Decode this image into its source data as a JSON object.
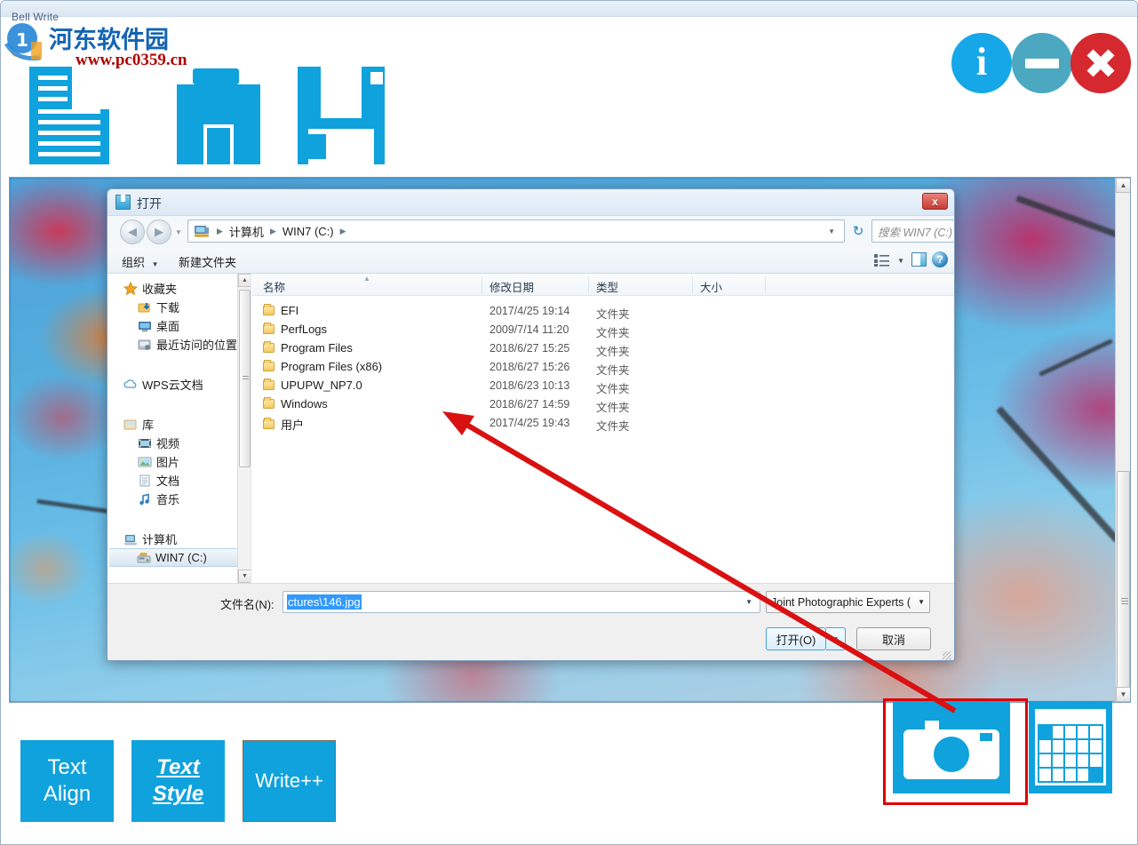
{
  "app": {
    "title": "Bell Write",
    "watermark": {
      "cn": "河东软件园",
      "url": "www.pc0359.cn"
    },
    "window_buttons": [
      {
        "name": "info",
        "glyph": "i",
        "color": "#16a7e8"
      },
      {
        "name": "minimize",
        "glyph": "",
        "color": "#4ca8c0"
      },
      {
        "name": "close",
        "glyph": "✕",
        "color": "#d5282f"
      }
    ],
    "top_tools": [
      {
        "name": "document-icon",
        "label": ""
      },
      {
        "name": "briefcase-icon",
        "label": ""
      },
      {
        "name": "save-floppy-icon",
        "label": ""
      }
    ],
    "bottom_buttons": [
      {
        "name": "text-align",
        "line1": "Text",
        "line2": "Align"
      },
      {
        "name": "text-style",
        "line1": "Text",
        "line2": "Style"
      },
      {
        "name": "write-plus-plus",
        "line1": "Write++",
        "line2": ""
      }
    ],
    "bottom_right_buttons": [
      {
        "name": "camera-icon",
        "label": ""
      },
      {
        "name": "table-grid-icon",
        "label": ""
      }
    ],
    "accent_color": "#0fa2dd",
    "highlight_color": "#e00000"
  },
  "dialog": {
    "title": "打开",
    "close_label": "x",
    "nav": {
      "back": "◀",
      "forward": "▶",
      "history_caret": "▼",
      "address_crumbs": [
        "计算机",
        "WIN7 (C:)"
      ],
      "crumb_sep": "▶",
      "address_caret": "▼",
      "refresh": "↻"
    },
    "search": {
      "placeholder": "搜索 WIN7 (C:)",
      "icon": "search-icon"
    },
    "commands": {
      "organize": "组织",
      "organize_caret": "▼",
      "new_folder": "新建文件夹",
      "view_caret": "▼",
      "help": "?"
    },
    "sidebar": [
      {
        "label": "收藏夹",
        "icon": "star-icon",
        "level": "group"
      },
      {
        "label": "下载",
        "icon": "download-icon",
        "level": "child"
      },
      {
        "label": "桌面",
        "icon": "desktop-icon",
        "level": "child"
      },
      {
        "label": "最近访问的位置",
        "icon": "recent-icon",
        "level": "child"
      },
      {
        "label": "WPS云文档",
        "icon": "cloud-icon",
        "level": "group"
      },
      {
        "label": "库",
        "icon": "library-icon",
        "level": "group"
      },
      {
        "label": "视频",
        "icon": "video-icon",
        "level": "child"
      },
      {
        "label": "图片",
        "icon": "picture-icon",
        "level": "child"
      },
      {
        "label": "文档",
        "icon": "document-icon",
        "level": "child"
      },
      {
        "label": "音乐",
        "icon": "music-icon",
        "level": "child"
      },
      {
        "label": "计算机",
        "icon": "computer-icon",
        "level": "group"
      },
      {
        "label": "WIN7 (C:)",
        "icon": "drive-icon",
        "level": "child",
        "selected": true
      }
    ],
    "columns": [
      "名称",
      "修改日期",
      "类型",
      "大小"
    ],
    "files": [
      {
        "name": "EFI",
        "date": "2017/4/25 19:14",
        "type": "文件夹",
        "size": ""
      },
      {
        "name": "PerfLogs",
        "date": "2009/7/14 11:20",
        "type": "文件夹",
        "size": ""
      },
      {
        "name": "Program Files",
        "date": "2018/6/27 15:25",
        "type": "文件夹",
        "size": ""
      },
      {
        "name": "Program Files (x86)",
        "date": "2018/6/27 15:26",
        "type": "文件夹",
        "size": ""
      },
      {
        "name": "UPUPW_NP7.0",
        "date": "2018/6/23 10:13",
        "type": "文件夹",
        "size": ""
      },
      {
        "name": "Windows",
        "date": "2018/6/27 14:59",
        "type": "文件夹",
        "size": ""
      },
      {
        "name": "用户",
        "date": "2017/4/25 19:43",
        "type": "文件夹",
        "size": ""
      }
    ],
    "footer": {
      "filename_label": "文件名(N):",
      "filename_value": "ctures\\146.jpg",
      "filename_caret": "▼",
      "filetype_value": "Joint Photographic Experts (",
      "filetype_caret": "▼",
      "open_button": "打开(O)",
      "open_split_caret": "▼",
      "cancel_button": "取消"
    }
  }
}
